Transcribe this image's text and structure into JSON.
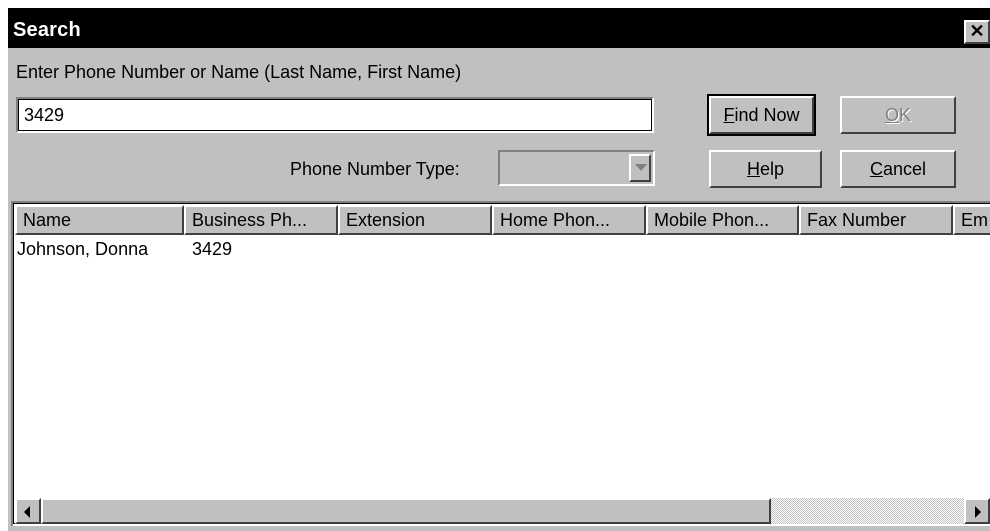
{
  "window": {
    "title": "Search",
    "close_glyph": "✕"
  },
  "search": {
    "prompt": "Enter Phone Number or Name (Last Name, First Name)",
    "value": "3429",
    "phone_type_label": "Phone Number Type:",
    "phone_type_value": ""
  },
  "buttons": {
    "find_now": {
      "prefix": "",
      "mnemonic": "F",
      "rest": "ind Now"
    },
    "ok": {
      "prefix": "",
      "mnemonic": "O",
      "rest": "K"
    },
    "help": {
      "prefix": "",
      "mnemonic": "H",
      "rest": "elp"
    },
    "cancel": {
      "prefix": "",
      "mnemonic": "C",
      "rest": "ancel"
    }
  },
  "results": {
    "columns": [
      "Name",
      "Business Ph...",
      "Extension",
      "Home Phon...",
      "Mobile Phon...",
      "Fax Number",
      "Em"
    ],
    "rows": [
      [
        "Johnson, Donna",
        "3429",
        "",
        "",
        "",
        "",
        ""
      ]
    ]
  }
}
